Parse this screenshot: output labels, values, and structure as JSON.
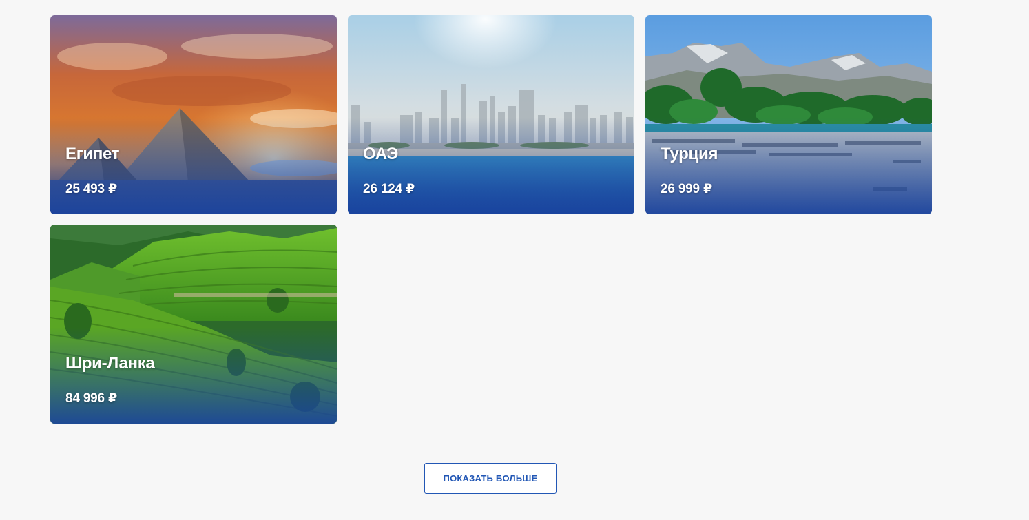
{
  "destinations": [
    {
      "name": "Египет",
      "price": "25 493 ₽",
      "image": "pyramids-sunset"
    },
    {
      "name": "ОАЭ",
      "price": "26 124 ₽",
      "image": "dubai-skyline-beach"
    },
    {
      "name": "Турция",
      "price": "26 999 ₽",
      "image": "mountain-beach-umbrellas"
    },
    {
      "name": "Шри-Ланка",
      "price": "84 996 ₽",
      "image": "tea-plantation-hills"
    }
  ],
  "show_more_label": "ПОКАЗАТЬ БОЛЬШЕ",
  "colors": {
    "background": "#f7f7f7",
    "accent": "#2257b5",
    "card_overlay": "#1c46a0"
  }
}
